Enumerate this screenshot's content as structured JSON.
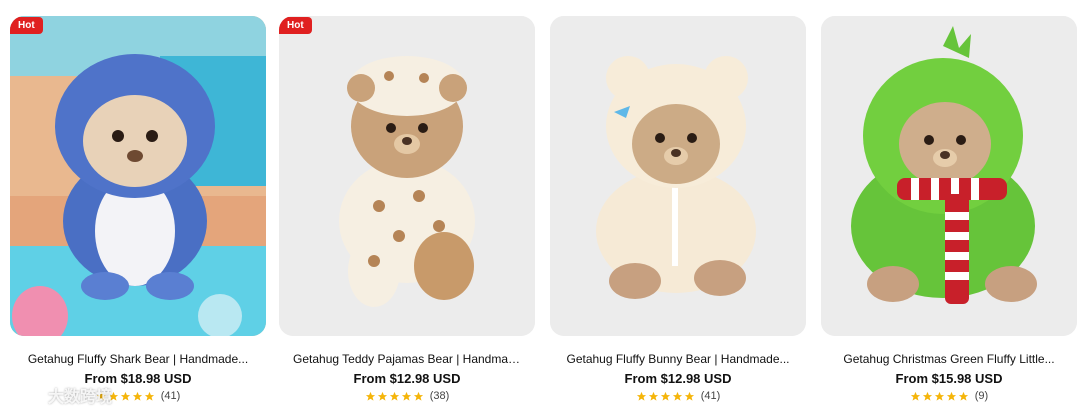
{
  "products": [
    {
      "badge": "Hot",
      "title": "Getahug Fluffy Shark Bear | Handmade...",
      "price": "From $18.98 USD",
      "rating_stars": 5,
      "review_count": "(41)",
      "image_bg": "#7fd4e6"
    },
    {
      "badge": "Hot",
      "title": "Getahug Teddy Pajamas Bear | Handmad...",
      "price": "From $12.98 USD",
      "rating_stars": 5,
      "review_count": "(38)",
      "image_bg": "#ececec"
    },
    {
      "badge": "",
      "title": "Getahug Fluffy Bunny Bear | Handmade...",
      "price": "From $12.98 USD",
      "rating_stars": 5,
      "review_count": "(41)",
      "image_bg": "#ececec"
    },
    {
      "badge": "",
      "title": "Getahug Christmas Green Fluffy Little...",
      "price": "From $15.98 USD",
      "rating_stars": 5,
      "review_count": "(9)",
      "image_bg": "#ececec"
    }
  ],
  "colors": {
    "badge_bg": "#e02020",
    "star": "#f5b50a",
    "text": "#111111"
  },
  "watermark": {
    "text": "大数跨境"
  }
}
